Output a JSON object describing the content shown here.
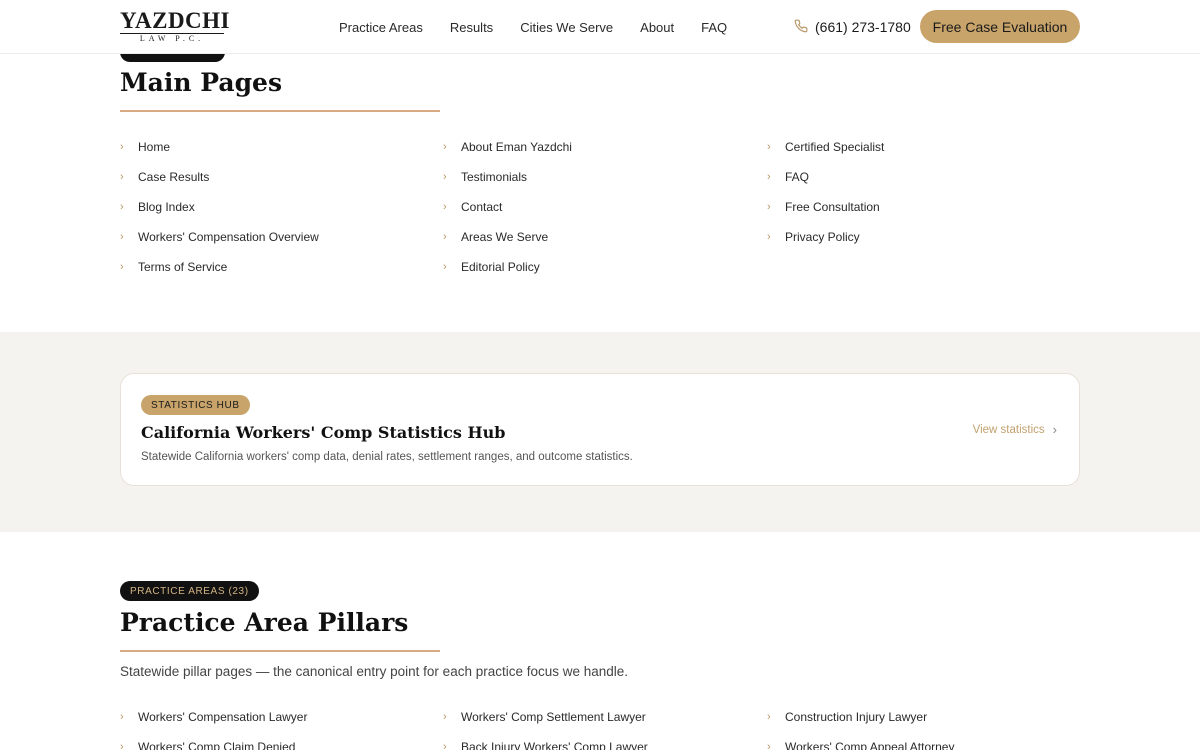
{
  "header": {
    "logo_main": "YAZDCHI",
    "logo_sub": "LAW P.C.",
    "nav": [
      "Practice Areas",
      "Results",
      "Cities We Serve",
      "About",
      "FAQ"
    ],
    "phone": "(661) 273-1780",
    "cta": "Free Case Evaluation"
  },
  "main_pages": {
    "title": "Main Pages",
    "columns": [
      [
        "Home",
        "Case Results",
        "Blog Index",
        "Workers' Compensation Overview",
        "Terms of Service"
      ],
      [
        "About Eman Yazdchi",
        "Testimonials",
        "Contact",
        "Areas We Serve",
        "Editorial Policy"
      ],
      [
        "Certified Specialist",
        "FAQ",
        "Free Consultation",
        "Privacy Policy"
      ]
    ]
  },
  "stats_card": {
    "badge": "STATISTICS HUB",
    "title": "California Workers' Comp Statistics Hub",
    "description": "Statewide California workers' comp data, denial rates, settlement ranges, and outcome statistics.",
    "link": "View statistics"
  },
  "practice_areas": {
    "badge": "PRACTICE AREAS (23)",
    "title": "Practice Area Pillars",
    "intro": "Statewide pillar pages — the canonical entry point for each practice focus we handle.",
    "columns": [
      [
        "Workers' Compensation Lawyer",
        "Workers' Comp Claim Denied"
      ],
      [
        "Workers' Comp Settlement Lawyer",
        "Back Injury Workers' Comp Lawyer"
      ],
      [
        "Construction Injury Lawyer",
        "Workers' Comp Appeal Attorney"
      ]
    ]
  },
  "colors": {
    "accent": "#c8a46a",
    "rule": "#d9ab82",
    "band": "#f5f3ef",
    "pill_dark": "#111111"
  }
}
